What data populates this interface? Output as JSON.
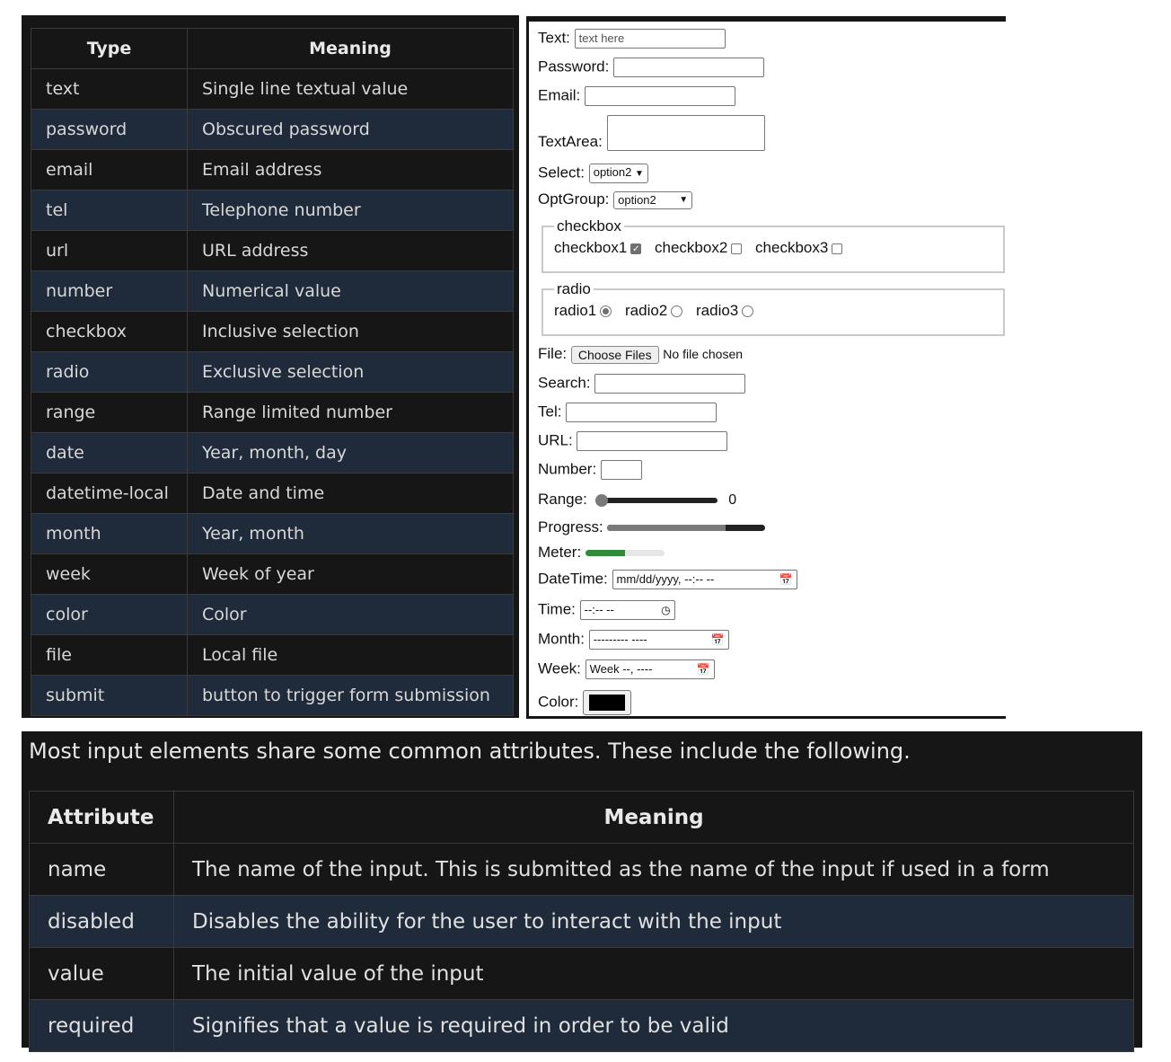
{
  "types_table": {
    "headers": [
      "Type",
      "Meaning"
    ],
    "rows": [
      [
        "text",
        "Single line textual value"
      ],
      [
        "password",
        "Obscured password"
      ],
      [
        "email",
        "Email address"
      ],
      [
        "tel",
        "Telephone number"
      ],
      [
        "url",
        "URL address"
      ],
      [
        "number",
        "Numerical value"
      ],
      [
        "checkbox",
        "Inclusive selection"
      ],
      [
        "radio",
        "Exclusive selection"
      ],
      [
        "range",
        "Range limited number"
      ],
      [
        "date",
        "Year, month, day"
      ],
      [
        "datetime-local",
        "Date and time"
      ],
      [
        "month",
        "Year, month"
      ],
      [
        "week",
        "Week of year"
      ],
      [
        "color",
        "Color"
      ],
      [
        "file",
        "Local file"
      ],
      [
        "submit",
        "button to trigger form submission"
      ]
    ]
  },
  "form": {
    "text_label": "Text:",
    "text_placeholder": "text here",
    "password_label": "Password:",
    "email_label": "Email:",
    "textarea_label": "TextArea:",
    "select_label": "Select:",
    "select_value": "option2",
    "optgroup_label": "OptGroup:",
    "optgroup_value": "option2",
    "checkbox_legend": "checkbox",
    "checkboxes": [
      {
        "label": "checkbox1",
        "checked": true
      },
      {
        "label": "checkbox2",
        "checked": false
      },
      {
        "label": "checkbox3",
        "checked": false
      }
    ],
    "radio_legend": "radio",
    "radios": [
      {
        "label": "radio1",
        "checked": true
      },
      {
        "label": "radio2",
        "checked": false
      },
      {
        "label": "radio3",
        "checked": false
      }
    ],
    "file_label": "File:",
    "file_button": "Choose Files",
    "file_status": "No file chosen",
    "search_label": "Search:",
    "tel_label": "Tel:",
    "url_label": "URL:",
    "number_label": "Number:",
    "range_label": "Range:",
    "range_value": "0",
    "progress_label": "Progress:",
    "progress_fraction": 0.75,
    "meter_label": "Meter:",
    "meter_fraction": 0.5,
    "meter_color": "#2e8b3a",
    "datetime_label": "DateTime:",
    "datetime_value": "mm/dd/yyyy, --:-- --",
    "time_label": "Time:",
    "time_value": "--:-- --",
    "month_label": "Month:",
    "month_value": "--------- ----",
    "week_label": "Week:",
    "week_value": "Week --, ----",
    "color_label": "Color:",
    "color_value": "#000000"
  },
  "attributes": {
    "intro": "Most input elements share some common attributes. These include the following.",
    "headers": [
      "Attribute",
      "Meaning"
    ],
    "rows": [
      [
        "name",
        "The name of the input. This is submitted as the name of the input if used in a form"
      ],
      [
        "disabled",
        "Disables the ability for the user to interact with the input"
      ],
      [
        "value",
        "The initial value of the input"
      ],
      [
        "required",
        "Signifies that a value is required in order to be valid"
      ]
    ]
  }
}
